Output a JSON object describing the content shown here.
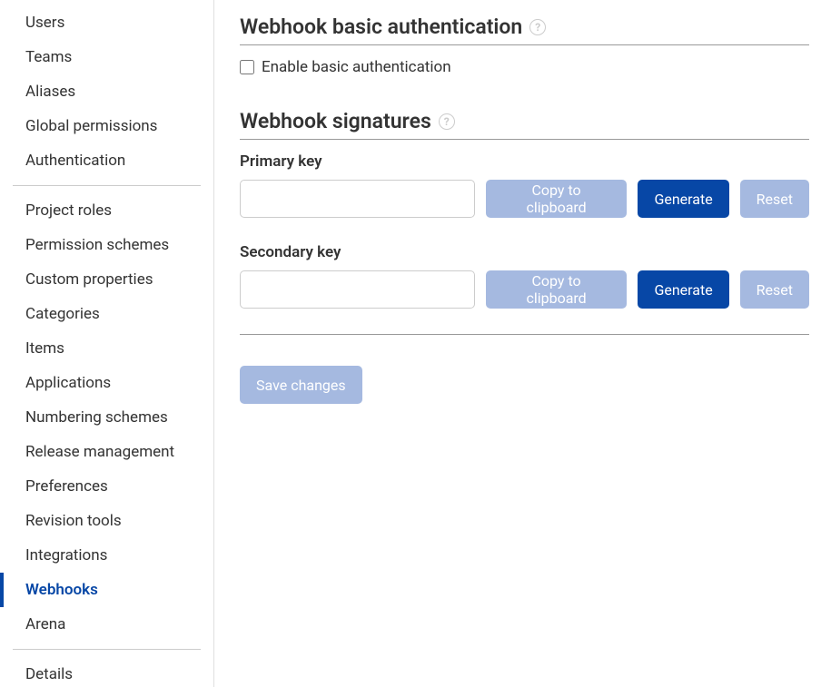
{
  "sidebar": {
    "items": [
      {
        "label": "Users",
        "active": false
      },
      {
        "label": "Teams",
        "active": false
      },
      {
        "label": "Aliases",
        "active": false
      },
      {
        "label": "Global permissions",
        "active": false
      },
      {
        "label": "Authentication",
        "active": false
      }
    ],
    "items2": [
      {
        "label": "Project roles",
        "active": false
      },
      {
        "label": "Permission schemes",
        "active": false
      },
      {
        "label": "Custom properties",
        "active": false
      },
      {
        "label": "Categories",
        "active": false
      },
      {
        "label": "Items",
        "active": false
      },
      {
        "label": "Applications",
        "active": false
      },
      {
        "label": "Numbering schemes",
        "active": false
      },
      {
        "label": "Release management",
        "active": false
      },
      {
        "label": "Preferences",
        "active": false
      },
      {
        "label": "Revision tools",
        "active": false
      },
      {
        "label": "Integrations",
        "active": false
      },
      {
        "label": "Webhooks",
        "active": true
      },
      {
        "label": "Arena",
        "active": false
      }
    ],
    "items3": [
      {
        "label": "Details",
        "active": false
      }
    ]
  },
  "sections": {
    "basic_auth": {
      "title": "Webhook basic authentication",
      "checkbox_label": "Enable basic authentication",
      "checked": false
    },
    "signatures": {
      "title": "Webhook signatures",
      "primary_label": "Primary key",
      "primary_value": "",
      "secondary_label": "Secondary key",
      "secondary_value": ""
    }
  },
  "buttons": {
    "copy": "Copy to clipboard",
    "generate": "Generate",
    "reset": "Reset",
    "save": "Save changes"
  },
  "help_glyph": "?"
}
